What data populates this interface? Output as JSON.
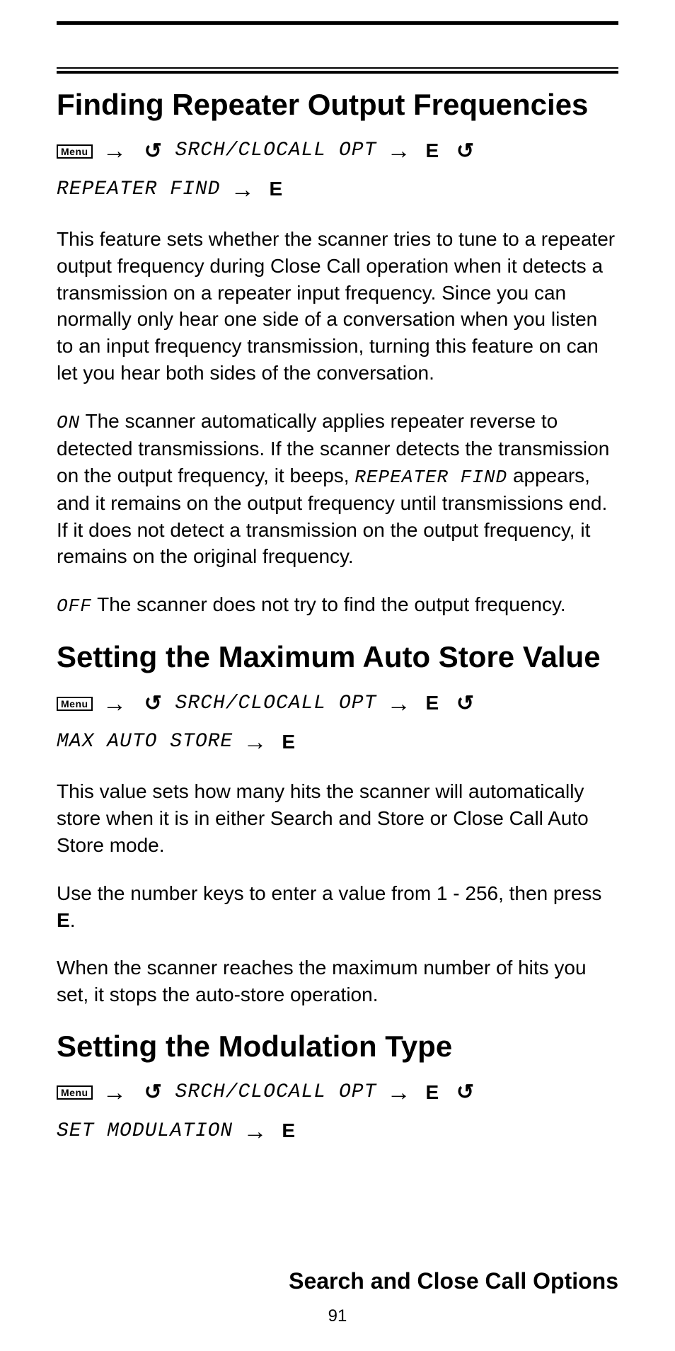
{
  "page_number": "91",
  "footer_title": "Search and Close Call Options",
  "menu_label": "Menu",
  "e_key": "E",
  "sections": [
    {
      "heading": "Finding Repeater Output Frequencies",
      "nav_item_1": "SRCH/CLOCALL OPT",
      "nav_item_2": "REPEATER FIND",
      "paragraphs": [
        {
          "text": "This feature sets whether the scanner tries to tune to a repeater output frequency during Close Call operation when it detects a transmission on a repeater input frequency. Since you can normally only hear one side of a conversation when you listen to an input frequency transmission, turning this feature on can let you hear both sides of the conversation."
        },
        {
          "prefix_lcd": "ON",
          "text_1": " The scanner automatically applies repeater reverse to detected transmissions. If the scanner detects the transmission on the output frequency, it beeps, ",
          "mid_lcd": "REPEATER FIND",
          "text_2": " appears, and it remains on the output frequency until transmissions end. If it does not detect a transmission on the output frequency, it remains on the original frequency."
        },
        {
          "prefix_lcd": "OFF",
          "text_1": "  The scanner does not try to find the output frequency."
        }
      ]
    },
    {
      "heading": "Setting the Maximum Auto Store Value",
      "nav_item_1": "SRCH/CLOCALL OPT",
      "nav_item_2": "MAX AUTO STORE",
      "paragraphs": [
        {
          "text": "This value sets how many hits the scanner will automatically store when it is in either Search and Store or Close Call Auto Store mode."
        },
        {
          "text_1": "Use the number keys to enter a value from 1 - 256, then press ",
          "bold": "E",
          "text_2": "."
        },
        {
          "text": "When the scanner reaches the maximum number of hits you set, it stops the auto-store operation."
        }
      ]
    },
    {
      "heading": "Setting the Modulation Type",
      "nav_item_1": "SRCH/CLOCALL OPT",
      "nav_item_2": "SET MODULATION"
    }
  ]
}
